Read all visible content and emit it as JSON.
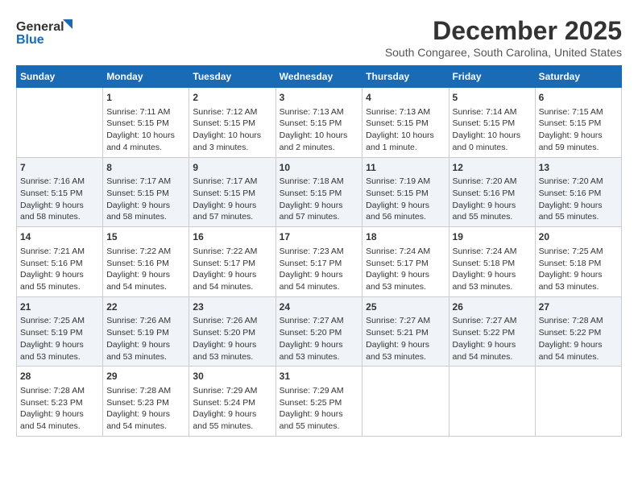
{
  "logo": {
    "line1": "General",
    "line2": "Blue"
  },
  "title": "December 2025",
  "subtitle": "South Congaree, South Carolina, United States",
  "days_header": [
    "Sunday",
    "Monday",
    "Tuesday",
    "Wednesday",
    "Thursday",
    "Friday",
    "Saturday"
  ],
  "weeks": [
    [
      {
        "day": "",
        "info": ""
      },
      {
        "day": "1",
        "info": "Sunrise: 7:11 AM\nSunset: 5:15 PM\nDaylight: 10 hours\nand 4 minutes."
      },
      {
        "day": "2",
        "info": "Sunrise: 7:12 AM\nSunset: 5:15 PM\nDaylight: 10 hours\nand 3 minutes."
      },
      {
        "day": "3",
        "info": "Sunrise: 7:13 AM\nSunset: 5:15 PM\nDaylight: 10 hours\nand 2 minutes."
      },
      {
        "day": "4",
        "info": "Sunrise: 7:13 AM\nSunset: 5:15 PM\nDaylight: 10 hours\nand 1 minute."
      },
      {
        "day": "5",
        "info": "Sunrise: 7:14 AM\nSunset: 5:15 PM\nDaylight: 10 hours\nand 0 minutes."
      },
      {
        "day": "6",
        "info": "Sunrise: 7:15 AM\nSunset: 5:15 PM\nDaylight: 9 hours\nand 59 minutes."
      }
    ],
    [
      {
        "day": "7",
        "info": "Sunrise: 7:16 AM\nSunset: 5:15 PM\nDaylight: 9 hours\nand 58 minutes."
      },
      {
        "day": "8",
        "info": "Sunrise: 7:17 AM\nSunset: 5:15 PM\nDaylight: 9 hours\nand 58 minutes."
      },
      {
        "day": "9",
        "info": "Sunrise: 7:17 AM\nSunset: 5:15 PM\nDaylight: 9 hours\nand 57 minutes."
      },
      {
        "day": "10",
        "info": "Sunrise: 7:18 AM\nSunset: 5:15 PM\nDaylight: 9 hours\nand 57 minutes."
      },
      {
        "day": "11",
        "info": "Sunrise: 7:19 AM\nSunset: 5:15 PM\nDaylight: 9 hours\nand 56 minutes."
      },
      {
        "day": "12",
        "info": "Sunrise: 7:20 AM\nSunset: 5:16 PM\nDaylight: 9 hours\nand 55 minutes."
      },
      {
        "day": "13",
        "info": "Sunrise: 7:20 AM\nSunset: 5:16 PM\nDaylight: 9 hours\nand 55 minutes."
      }
    ],
    [
      {
        "day": "14",
        "info": "Sunrise: 7:21 AM\nSunset: 5:16 PM\nDaylight: 9 hours\nand 55 minutes."
      },
      {
        "day": "15",
        "info": "Sunrise: 7:22 AM\nSunset: 5:16 PM\nDaylight: 9 hours\nand 54 minutes."
      },
      {
        "day": "16",
        "info": "Sunrise: 7:22 AM\nSunset: 5:17 PM\nDaylight: 9 hours\nand 54 minutes."
      },
      {
        "day": "17",
        "info": "Sunrise: 7:23 AM\nSunset: 5:17 PM\nDaylight: 9 hours\nand 54 minutes."
      },
      {
        "day": "18",
        "info": "Sunrise: 7:24 AM\nSunset: 5:17 PM\nDaylight: 9 hours\nand 53 minutes."
      },
      {
        "day": "19",
        "info": "Sunrise: 7:24 AM\nSunset: 5:18 PM\nDaylight: 9 hours\nand 53 minutes."
      },
      {
        "day": "20",
        "info": "Sunrise: 7:25 AM\nSunset: 5:18 PM\nDaylight: 9 hours\nand 53 minutes."
      }
    ],
    [
      {
        "day": "21",
        "info": "Sunrise: 7:25 AM\nSunset: 5:19 PM\nDaylight: 9 hours\nand 53 minutes."
      },
      {
        "day": "22",
        "info": "Sunrise: 7:26 AM\nSunset: 5:19 PM\nDaylight: 9 hours\nand 53 minutes."
      },
      {
        "day": "23",
        "info": "Sunrise: 7:26 AM\nSunset: 5:20 PM\nDaylight: 9 hours\nand 53 minutes."
      },
      {
        "day": "24",
        "info": "Sunrise: 7:27 AM\nSunset: 5:20 PM\nDaylight: 9 hours\nand 53 minutes."
      },
      {
        "day": "25",
        "info": "Sunrise: 7:27 AM\nSunset: 5:21 PM\nDaylight: 9 hours\nand 53 minutes."
      },
      {
        "day": "26",
        "info": "Sunrise: 7:27 AM\nSunset: 5:22 PM\nDaylight: 9 hours\nand 54 minutes."
      },
      {
        "day": "27",
        "info": "Sunrise: 7:28 AM\nSunset: 5:22 PM\nDaylight: 9 hours\nand 54 minutes."
      }
    ],
    [
      {
        "day": "28",
        "info": "Sunrise: 7:28 AM\nSunset: 5:23 PM\nDaylight: 9 hours\nand 54 minutes."
      },
      {
        "day": "29",
        "info": "Sunrise: 7:28 AM\nSunset: 5:23 PM\nDaylight: 9 hours\nand 54 minutes."
      },
      {
        "day": "30",
        "info": "Sunrise: 7:29 AM\nSunset: 5:24 PM\nDaylight: 9 hours\nand 55 minutes."
      },
      {
        "day": "31",
        "info": "Sunrise: 7:29 AM\nSunset: 5:25 PM\nDaylight: 9 hours\nand 55 minutes."
      },
      {
        "day": "",
        "info": ""
      },
      {
        "day": "",
        "info": ""
      },
      {
        "day": "",
        "info": ""
      }
    ]
  ]
}
